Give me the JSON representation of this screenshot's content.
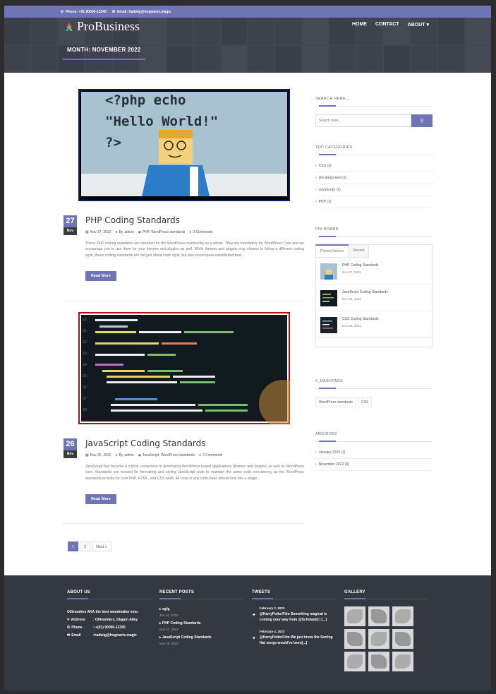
{
  "topbar": {
    "phone": "Phone: +91 90000-12345",
    "email": "Email: hadwig@hogwarts.magic"
  },
  "brand": {
    "name": "ProBusiness"
  },
  "nav": [
    "HOME",
    "CONTACT",
    "ABOUT"
  ],
  "page_title": "MONTH: NOVEMBER 2022",
  "posts": [
    {
      "day": "27",
      "month": "Nov",
      "title": "PHP Coding Standards",
      "date": "Nov 27, 2022",
      "author_prefix": "By",
      "author": "admin",
      "categories": "PHP, WordPress standards",
      "comments": "0 Comments",
      "excerpt": "These PHP coding standards are intended for the WordPress community as a whole. They are mandatory for WordPress Core and we encourage you to use them for your themes and plugins as well. While themes and plugins may choose to follow a different coding style, these coding standards are not just about code style, but also encompass established best...",
      "read_more": "Read More",
      "image_code": [
        "<?php echo",
        "\"Hello World!\"",
        "?>"
      ]
    },
    {
      "day": "26",
      "month": "Nov",
      "title": "JavaScript Coding Standards",
      "date": "Nov 26, 2022",
      "author_prefix": "By",
      "author": "admin",
      "categories": "JavaScript, WordPress standards",
      "comments": "0 Comments",
      "excerpt": "JavaScript has become a critical component in developing WordPress-based applications (themes and plugins) as well as WordPress core. Standards are needed for formatting and styling JavaScript code to maintain the same code consistency as the WordPress standards provide for core PHP, HTML, and CSS code. All code in any code-base should look like a single...",
      "read_more": "Read More"
    }
  ],
  "pagination": [
    "1",
    "2",
    "Next »"
  ],
  "sidebar": {
    "search_title": "SEARCH HERE...",
    "search_placeholder": "Search here...",
    "categories_title": "TOP CATEGORIES",
    "categories": [
      "CSS (2)",
      "Uncategorized (1)",
      "JavaScript (1)",
      "PHP (1)"
    ],
    "pinboard_title": "PIN BOARD",
    "tabs": [
      "Pinned Notices",
      "Recent"
    ],
    "pins": [
      {
        "title": "PHP Coding Standards",
        "date": "Nov 27, 2022"
      },
      {
        "title": "JavaScript Coding Standards",
        "date": "Nov 26, 2022"
      },
      {
        "title": "CSS Coding Standards",
        "date": "Nov 26, 2022"
      }
    ],
    "hashtag_title": "#_HASHTAGS",
    "hashtags": [
      "WordPress standards",
      "CSS"
    ],
    "archives_title": "ARCHIVES",
    "archives": [
      "January 2023 (1)",
      "November 2022 (4)"
    ]
  },
  "footer": {
    "about_title": "ABOUT US",
    "about_text": "Ollivanders AKA the best wandmaker ever.",
    "address_label": "Address",
    "address_value": ": Ollivanders, Diagon Alley",
    "phone_label": "Phone",
    "phone_value": ": +(91) 90000-12345",
    "email_label": "Email",
    "email_value": ":hadwig@hogwarts.magic",
    "recent_title": "RECENT POSTS",
    "recent": [
      {
        "title": "sgfg",
        "date": "Jan 14, 2023"
      },
      {
        "title": "PHP Coding Standards",
        "date": "Nov 27, 2022"
      },
      {
        "title": "JavaScript Coding Standards",
        "date": "Nov 26, 2022"
      }
    ],
    "tweets_title": "TWEETS",
    "tweets": [
      {
        "date": "February 2, 2023",
        "handle": "@HarryPotterFilm",
        "text": "Something magical is coming your way from @Scholastic! [...]"
      },
      {
        "date": "February 4, 2023",
        "handle": "@HarryPotterFilm",
        "text": "We just know the Sorting Hat songs would've been[...]"
      }
    ],
    "gallery_title": "GALLERY"
  },
  "colors": {
    "accent": "#6e74b5",
    "footer_bg": "#343841"
  }
}
